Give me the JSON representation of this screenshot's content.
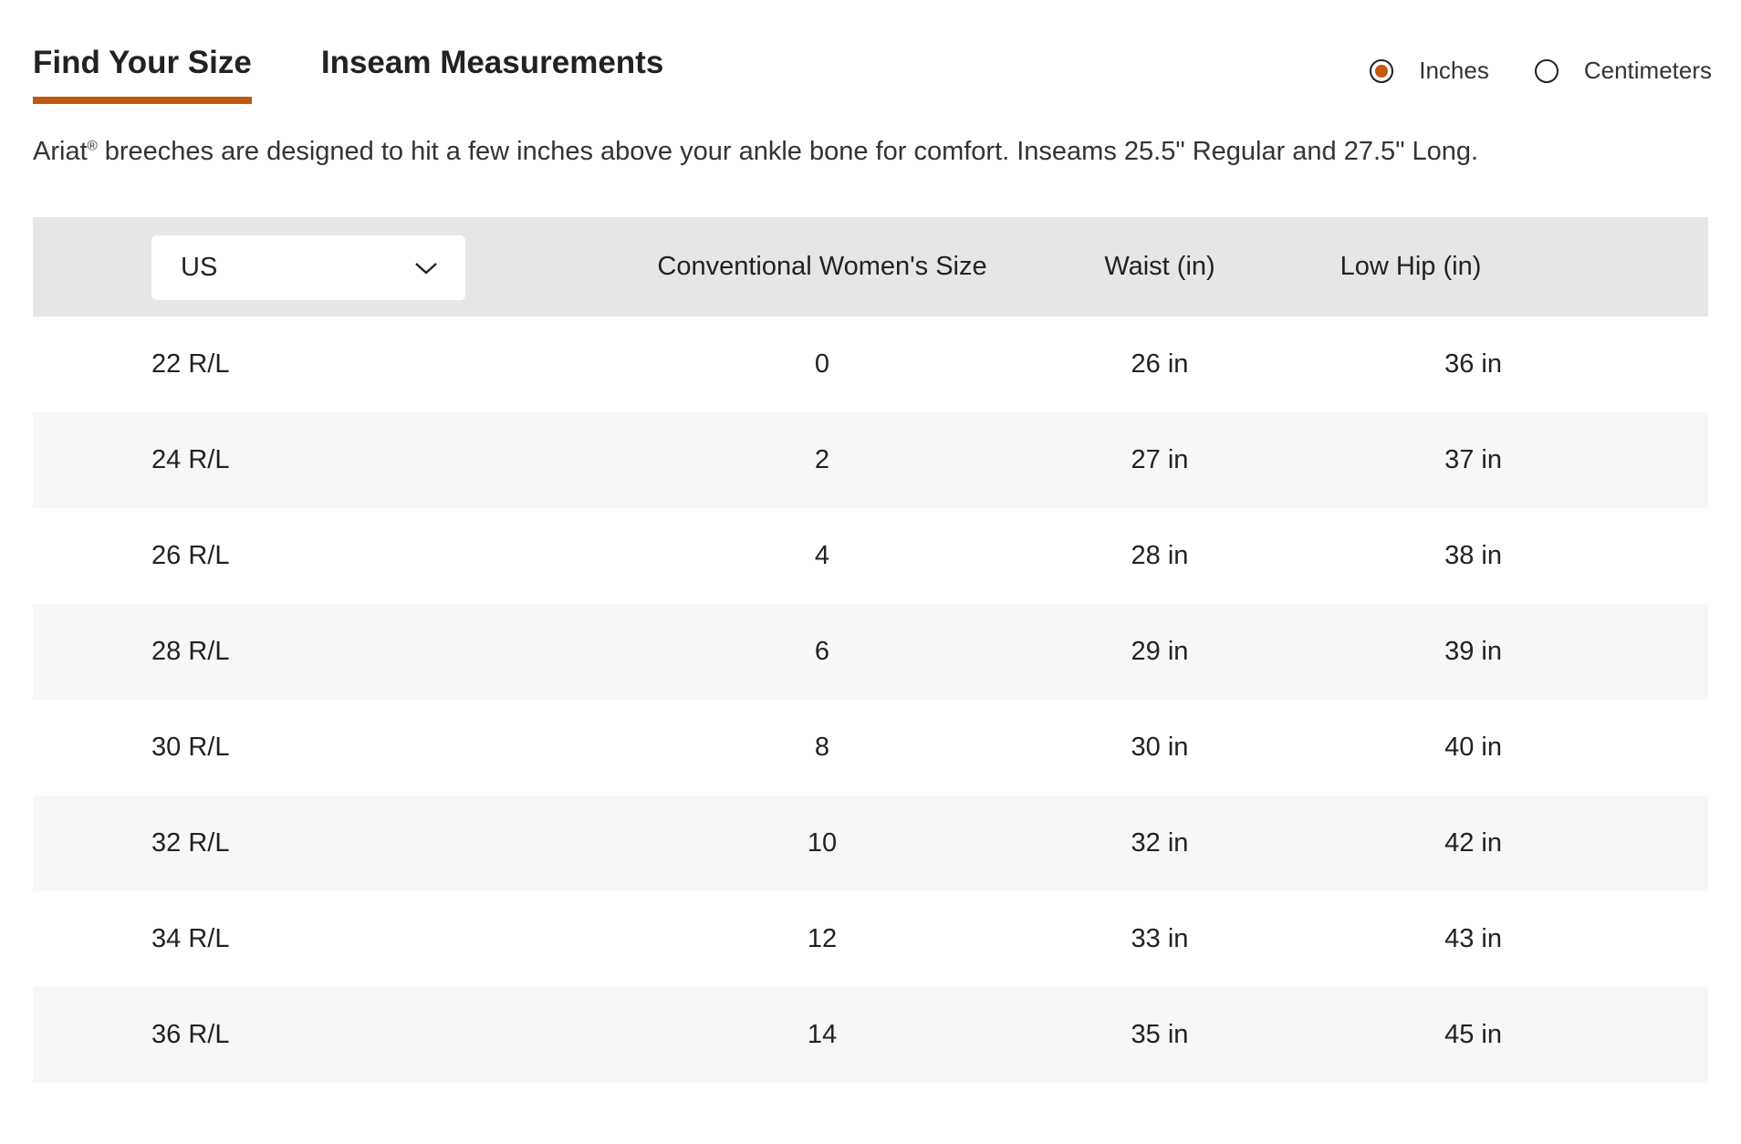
{
  "tabs": [
    {
      "label": "Find Your Size",
      "active": true
    },
    {
      "label": "Inseam Measurements",
      "active": false
    }
  ],
  "units": {
    "options": [
      {
        "label": "Inches",
        "selected": true
      },
      {
        "label": "Centimeters",
        "selected": false
      }
    ]
  },
  "description": {
    "brand": "Ariat",
    "reg_mark": "®",
    "text": " breeches are designed to hit a few inches above your ankle bone for comfort. Inseams 25.5\" Regular and 27.5\" Long."
  },
  "table": {
    "region_select": {
      "value": "US"
    },
    "headers": {
      "conventional": "Conventional Women's Size",
      "waist": "Waist (in)",
      "low_hip": "Low Hip (in)"
    },
    "rows": [
      {
        "size": "22 R/L",
        "conventional": "0",
        "waist": "26 in",
        "low_hip": "36 in"
      },
      {
        "size": "24 R/L",
        "conventional": "2",
        "waist": "27 in",
        "low_hip": "37 in"
      },
      {
        "size": "26 R/L",
        "conventional": "4",
        "waist": "28 in",
        "low_hip": "38 in"
      },
      {
        "size": "28 R/L",
        "conventional": "6",
        "waist": "29 in",
        "low_hip": "39 in"
      },
      {
        "size": "30 R/L",
        "conventional": "8",
        "waist": "30 in",
        "low_hip": "40 in"
      },
      {
        "size": "32 R/L",
        "conventional": "10",
        "waist": "32 in",
        "low_hip": "42 in"
      },
      {
        "size": "34 R/L",
        "conventional": "12",
        "waist": "33 in",
        "low_hip": "43 in"
      },
      {
        "size": "36 R/L",
        "conventional": "14",
        "waist": "35 in",
        "low_hip": "45 in"
      }
    ]
  },
  "colors": {
    "accent": "#c15a0f",
    "header_bg": "#e6e6e6",
    "alt_row_bg": "#f7f7f7"
  },
  "icons": {
    "select": "chevron-down-icon"
  }
}
